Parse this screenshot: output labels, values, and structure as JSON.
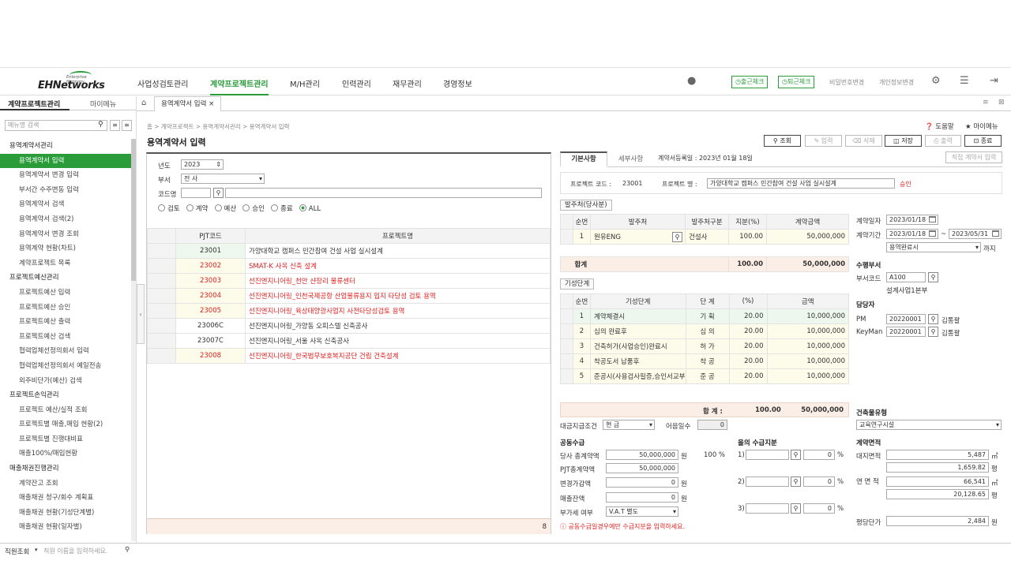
{
  "header": {
    "logo": "EHNetworks",
    "logo_sub": "Enterprise Harmony",
    "nav": [
      "사업성검토관리",
      "계약프로젝트관리",
      "M/H관리",
      "인력관리",
      "재무관리",
      "경영정보"
    ],
    "checkin": "출근체크",
    "checkout": "퇴근체크",
    "pwd": "비밀번호변경",
    "profile": "개인정보변경"
  },
  "sidebar": {
    "tab1": "계약프로젝트관리",
    "tab2": "마이메뉴",
    "search": "메뉴명 검색",
    "items": [
      {
        "t": "용역계약서관리",
        "g": true
      },
      {
        "t": "용역계약서 입력",
        "a": true
      },
      {
        "t": "용역계약서 변경 입력"
      },
      {
        "t": "부서간 수주변동 입력"
      },
      {
        "t": "용역계약서 검색"
      },
      {
        "t": "용역계약서 검색(2)"
      },
      {
        "t": "용역계약서 변경 조회"
      },
      {
        "t": "용역계약 현황(차트)"
      },
      {
        "t": "계약프로젝트 목록"
      },
      {
        "t": "프로젝트예산관리",
        "g": true
      },
      {
        "t": "프로젝트예산 입력"
      },
      {
        "t": "프로젝트예산 승인"
      },
      {
        "t": "프로젝트예산 출력"
      },
      {
        "t": "프로젝트예산 검색"
      },
      {
        "t": "협력업체선정의회서 입력"
      },
      {
        "t": "협력업체선정의회서 예일전송"
      },
      {
        "t": "외주비단가(예산) 검색"
      },
      {
        "t": "프로젝트손익관리",
        "g": true
      },
      {
        "t": "프로젝트 예산/실적 조회"
      },
      {
        "t": "프로젝트별 매출,매입 현황(2)"
      },
      {
        "t": "프로젝트별 진행대비표"
      },
      {
        "t": "매출100%/매입현황"
      },
      {
        "t": "매출채권진행관리",
        "g": true
      },
      {
        "t": "계약잔고 조회"
      },
      {
        "t": "매출채권 청구/회수 계획표"
      },
      {
        "t": "매출채권 현황(기성단계별)"
      },
      {
        "t": "매출채권 현황(일자별)"
      }
    ]
  },
  "bottom": {
    "label": "직원조회",
    "placeholder": "직원 이름을 입력하세요."
  },
  "tab": {
    "label": "용역계약서 입력"
  },
  "breadcrumb": "홈 > 계약프로젝트 > 용역계약서관리 > 용역계약서 입력",
  "title": "용역계약서 입력",
  "help": "도움말",
  "mymenu": "마이메뉴",
  "toolbar": {
    "search": "조회",
    "input": "입력",
    "del": "삭제",
    "save": "저장",
    "print": "출력",
    "close": "종료"
  },
  "filter": {
    "year_l": "년도",
    "year": "2023",
    "dept_l": "부서",
    "dept": "전      사",
    "code_l": "코드명",
    "opts": [
      "검토",
      "계약",
      "예산",
      "승인",
      "종료",
      "ALL"
    ]
  },
  "grid": {
    "h1": "PJT코드",
    "h2": "프로젝트명",
    "count": "8",
    "rows": [
      {
        "c": "23001",
        "n": "가양대학교 캠퍼스 민간참여 건설 사업 실시설계",
        "r": false
      },
      {
        "c": "23002",
        "n": "SMAT-K 사옥 신축 설계",
        "r": true
      },
      {
        "c": "23003",
        "n": "선진엔지니어링_천안 샨장리 물류센터",
        "r": true
      },
      {
        "c": "23004",
        "n": "선진엔지니어링_인천국제공항 산업물류용지 입지 타당성 검토 용역",
        "r": true
      },
      {
        "c": "23005",
        "n": "선진엔지니어링_육상태양광사업지 사전타당성검토 용역",
        "r": true
      },
      {
        "c": "23006C",
        "n": "선진엔지니어링_가양동 오피스텔 신축공사",
        "r": false
      },
      {
        "c": "23007C",
        "n": "선진엔지니어링_서울 사옥 신축공사",
        "r": false
      },
      {
        "c": "23008",
        "n": "선진엔지니어링_한국법무보호복지공단 건립 건축설계",
        "r": true
      }
    ]
  },
  "right": {
    "tab1": "기본사항",
    "tab2": "세부사항",
    "reg": "계약서등록일 : 2023년 01월 18일",
    "direct": "직접 계약서 입력",
    "pcode_l": "프로젝트 코드 :",
    "pcode": "23001",
    "pname_l": "프로젝트 명 :",
    "pname": "가양대학교 캠퍼스 민간참여 건설 사업 실시설계",
    "status": "승인",
    "client_sec": "발주처(당사분)",
    "client_h": [
      "순번",
      "발주처",
      "발주처구분",
      "지분(%)",
      "계약금액"
    ],
    "client_row": [
      "1",
      "원유ENG",
      "건설사",
      "100.00",
      "50,000,000"
    ],
    "total_l": "합계",
    "client_total": [
      "100.00",
      "50,000,000"
    ],
    "stage_sec": "기성단계",
    "stage_h": [
      "순번",
      "기성단계",
      "단  계",
      "(%)",
      "금액"
    ],
    "stages": [
      [
        "1",
        "계약체결시",
        "기  획",
        "20.00",
        "10,000,000"
      ],
      [
        "2",
        "심의 완료후",
        "심  의",
        "20.00",
        "10,000,000"
      ],
      [
        "3",
        "건축허가(사업승인)완료시",
        "허  가",
        "20.00",
        "10,000,000"
      ],
      [
        "4",
        "착공도서 납품후",
        "착  공",
        "20.00",
        "10,000,000"
      ],
      [
        "5",
        "준공시(사용검사필증,승인서교부",
        "준  공",
        "20.00",
        "10,000,000"
      ]
    ],
    "stage_total_l": "합  계 :",
    "stage_total": [
      "100.00",
      "50,000,000"
    ],
    "pay_l": "대금지급조건",
    "pay": "현  금",
    "bill_l": "어음일수",
    "bill": "0",
    "joint_l": "공동수급",
    "our_l": "당사 총계약액",
    "our": "50,000,000",
    "won": "원",
    "pct100": "100 %",
    "pjt_l": "PJT총계약액",
    "pjt": "50,000,000",
    "chg_l": "변경가감액",
    "chg": "0",
    "rem_l": "매출잔액",
    "rem": "0",
    "vat_l": "부가세 여부",
    "vat": "V.A.T 별도",
    "share_l": "을의 수급지분",
    "s1": "1)",
    "s2": "2)",
    "s3": "3)",
    "zero": "0",
    "pct": "%",
    "warn": "공동수급일경우에만 수급지분을 입력하세요.",
    "cdate_l": "계약일자",
    "cdate": "2023/01/18",
    "cper_l": "계약기간",
    "cfrom": "2023/01/18",
    "cto": "2023/05/31",
    "tilde": "~",
    "until": "용역완료시",
    "kkaji": "까지",
    "dept_h": "수행부서",
    "dept_code_l": "부서코드",
    "dept_code": "A100",
    "dept_name": "설계사업1본부",
    "mgr_h": "담당자",
    "pm_l": "PM",
    "pm": "20220001",
    "pm_n": "김통팔",
    "km_l": "KeyMan",
    "km": "20220001",
    "km_n": "김통팔",
    "btype_h": "건축물유형",
    "btype": "교육연구시설",
    "area_h": "계약면적",
    "site_l": "대지면적",
    "site": "5,487",
    "m2": "㎡",
    "site2": "1,659.82",
    "py": "평",
    "floor_l": "연 면 적",
    "floor": "66,541",
    "floor2": "20,128.65",
    "unit_l": "평당단가",
    "unit": "2,484"
  }
}
